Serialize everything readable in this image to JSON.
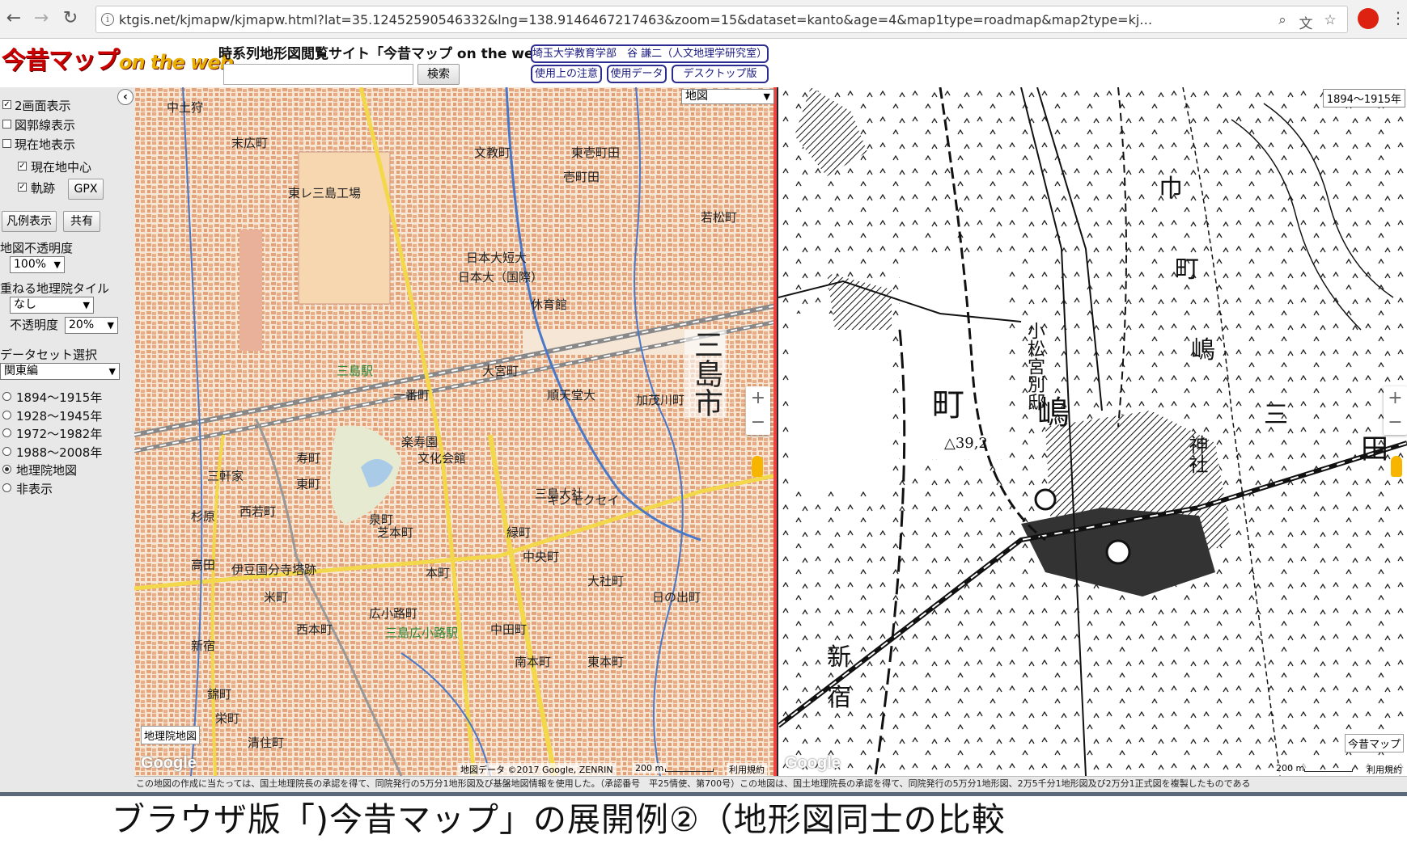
{
  "browser": {
    "url": "ktgis.net/kjmapw/kjmapw.html?lat=35.12452590546332&lng=138.9146467217463&zoom=15&dataset=kanto&age=4&map1type=roadmap&map2type=kj…"
  },
  "header": {
    "logo_text": "今昔マップ",
    "logo_sub": "on the web",
    "site_title": "時系列地形図閲覧サイト「今昔マップ on the web」",
    "search_placeholder": "",
    "search_button": "検索",
    "author": "埼玉大学教育学部　谷 謙二（人文地理学研究室）",
    "notes_button": "使用上の注意",
    "data_button": "使用データ",
    "desktop_button": "デスクトップ版"
  },
  "sidebar": {
    "dual_view": "2画面表示",
    "frame_lines": "図郭線表示",
    "current_loc": "現在地表示",
    "current_center": "現在地中心",
    "track": "軌跡",
    "gpx_button": "GPX",
    "legend_button": "凡例表示",
    "share_button": "共有",
    "opacity_label": "地図不透明度",
    "opacity_value": "100%",
    "gsi_tile_label": "重ねる地理院タイル",
    "gsi_tile_value": "なし",
    "gsi_opacity_label": "不透明度",
    "gsi_opacity_value": "20%",
    "dataset_label": "データセット選択",
    "dataset_value": "関東編",
    "eras": [
      "1894～1915年",
      "1928～1945年",
      "1972～1982年",
      "1988～2008年",
      "地理院地図",
      "非表示"
    ],
    "selected_era_index": 4
  },
  "map_left": {
    "type_select": "地図",
    "labels": [
      "三島市",
      "三島駅",
      "大宮町",
      "加茂川町",
      "日本大短大",
      "日本大（国際）",
      "休育館",
      "三島大社",
      "楽寿園",
      "文化会館",
      "西若町",
      "本町",
      "芝本町",
      "泉町",
      "寿町",
      "三軒家",
      "伊豆国分寺塔跡",
      "三島広小路駅",
      "西本町",
      "中田町",
      "南本町",
      "東本町",
      "大社町",
      "日の出町",
      "中央町",
      "壱町田",
      "若松町",
      "文教町",
      "東レ三島工場",
      "栄町",
      "清住町",
      "新宿",
      "錦町",
      "米町",
      "広小路町",
      "緑町",
      "東町",
      "一番町",
      "末広町",
      "中土狩",
      "順天堂大",
      "キンモクセイ",
      "杉原",
      "高田",
      "東壱町田"
    ],
    "stamp": "地理院地図",
    "copyright": "地図データ ©2017 Google, ZENRIN",
    "scale": "200 m",
    "terms": "利用規約",
    "google": "Google"
  },
  "map_right": {
    "era_badge": "1894～1915年",
    "labels": [
      "町",
      "嶋",
      "△39,2",
      "小松宮別邸",
      "三",
      "巾",
      "町",
      "嶋",
      "神社",
      "新",
      "宿",
      "田"
    ],
    "stamp": "今昔マップ",
    "scale": "200 m",
    "terms": "利用規約",
    "google": "Google"
  },
  "footer_strip": "この地図の作成に当たっては、国土地理院長の承認を得て、同院発行の5万分1地形図及び基盤地図情報を使用した。（承認番号　平25情使、第700号）この地図は、国土地理院長の承認を得て、同院発行の5万分1地形図、2万5千分1地形図及び2万分1正式図を複製したものである",
  "caption": "ブラウザ版「)今昔マップ」の展開例②（地形図同士の比較",
  "colors": {
    "roads_yellow": "#f2d84a",
    "buildings": "#e7a77d",
    "rail": "#777777"
  }
}
